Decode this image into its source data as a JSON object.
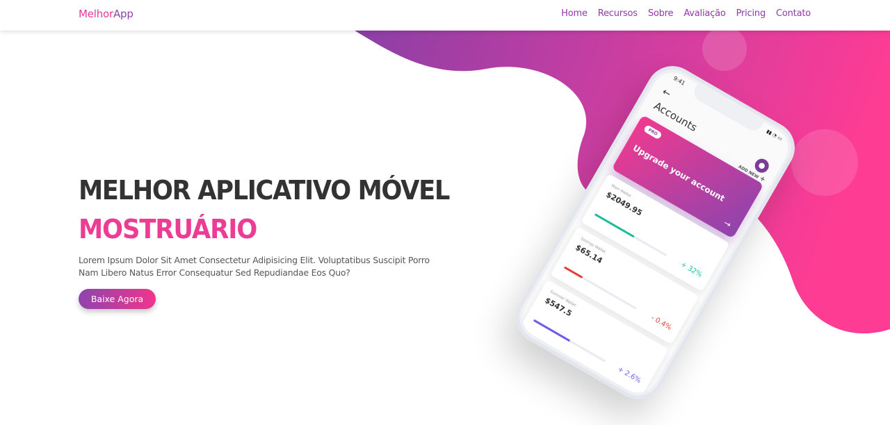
{
  "brand": {
    "part1": "Melhor",
    "part2": "App"
  },
  "nav": {
    "items": [
      {
        "label": "Home"
      },
      {
        "label": "Recursos"
      },
      {
        "label": "Sobre"
      },
      {
        "label": "Avaliação"
      },
      {
        "label": "Pricing"
      },
      {
        "label": "Contato"
      }
    ]
  },
  "hero": {
    "title": "MELHOR APLICATIVO MÓVEL",
    "subtitle": "MOSTRUÁRIO",
    "description": "Lorem Ipsum Dolor Sit Amet Consectetur Adipisicing Elit. Voluptatibus Suscipit Porro Nam Libero Natus Error Consequatur Sed Repudiandae Eos Quo?",
    "cta_label": "Baixe Agora"
  },
  "phone": {
    "time": "9:41",
    "title": "Accounts",
    "pro_label": "PRO",
    "promo_text": "Upgrade your account",
    "add_new": "ADD NEW",
    "wallets": [
      {
        "name": "Main Wallet",
        "amount": "$2049.95",
        "change": "+ 32%",
        "color": "#1abc9c",
        "progress": 0.55
      },
      {
        "name": "Savings Wallet",
        "amount": "$65.14",
        "change": "- 0.4%",
        "color": "#e0403a",
        "progress": 0.25
      },
      {
        "name": "Summer Wallet",
        "amount": "$547.5",
        "change": "+ 2.6%",
        "color": "#6c5ce7",
        "progress": 0.5
      }
    ]
  },
  "colors": {
    "accent_pink": "#ec3d95",
    "accent_purple": "#8e44ad",
    "nav_text": "#8e3aa8"
  }
}
